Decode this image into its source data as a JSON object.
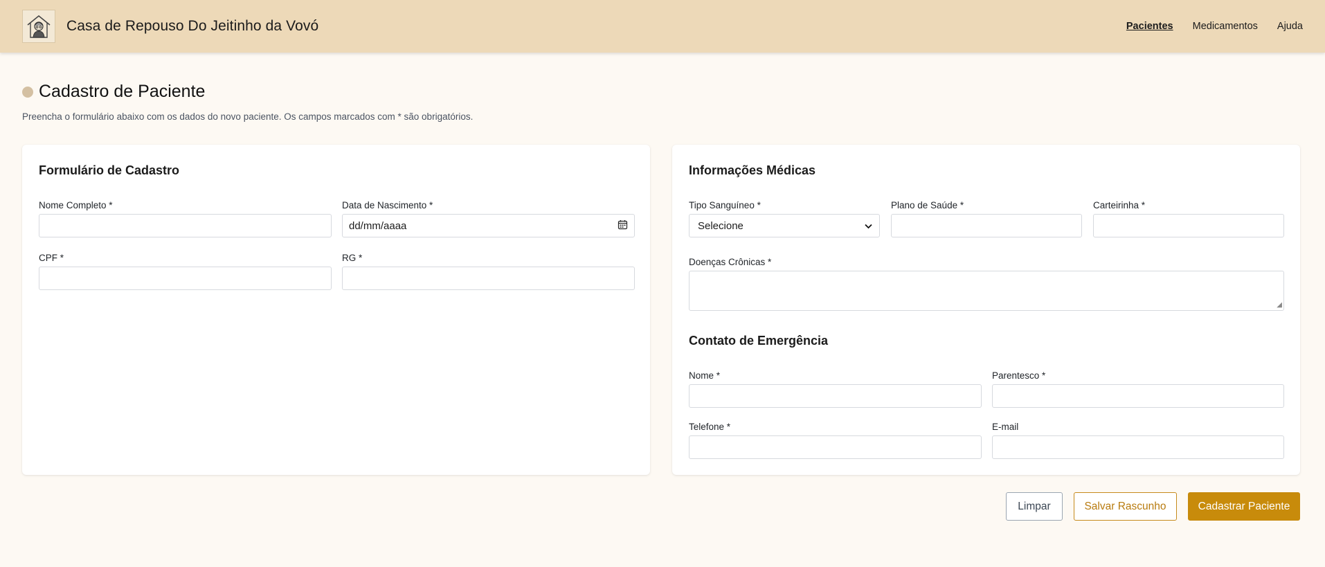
{
  "header": {
    "brand": "Casa de Repouso Do Jeitinho da Vovó",
    "logo_icon": "grandma-house-icon",
    "nav": [
      {
        "label": "Pacientes",
        "active": true
      },
      {
        "label": "Medicamentos",
        "active": false
      },
      {
        "label": "Ajuda",
        "active": false
      }
    ]
  },
  "page": {
    "title": "Cadastro de Paciente",
    "subtitle": "Preencha o formulário abaixo com os dados do novo paciente. Os campos marcados com * são obrigatórios."
  },
  "form": {
    "title": "Formulário de Cadastro",
    "nome_label": "Nome Completo *",
    "nome_value": "",
    "nascimento_label": "Data de Nascimento *",
    "nascimento_placeholder": "dd/mm/aaaa",
    "cpf_label": "CPF *",
    "cpf_value": "",
    "rg_label": "RG *",
    "rg_value": ""
  },
  "medical": {
    "title": "Informações Médicas",
    "tipo_label": "Tipo Sanguíneo *",
    "tipo_selected": "Selecione",
    "plano_label": "Plano de Saúde *",
    "plano_value": "",
    "carteirinha_label": "Carteirinha *",
    "carteirinha_value": "",
    "doencas_label": "Doenças Crônicas *",
    "doencas_value": ""
  },
  "emergency": {
    "title": "Contato de Emergência",
    "nome_label": "Nome *",
    "nome_value": "",
    "parentesco_label": "Parentesco *",
    "parentesco_value": "",
    "telefone_label": "Telefone *",
    "telefone_value": "",
    "email_label": "E-mail",
    "email_value": ""
  },
  "actions": {
    "clear": "Limpar",
    "draft": "Salvar Rascunho",
    "submit": "Cadastrar Paciente"
  },
  "colors": {
    "header_bg": "#edd9b8",
    "page_bg": "#fdf9f3",
    "accent": "#c88b0b",
    "title_dot": "#d4c0a2"
  }
}
